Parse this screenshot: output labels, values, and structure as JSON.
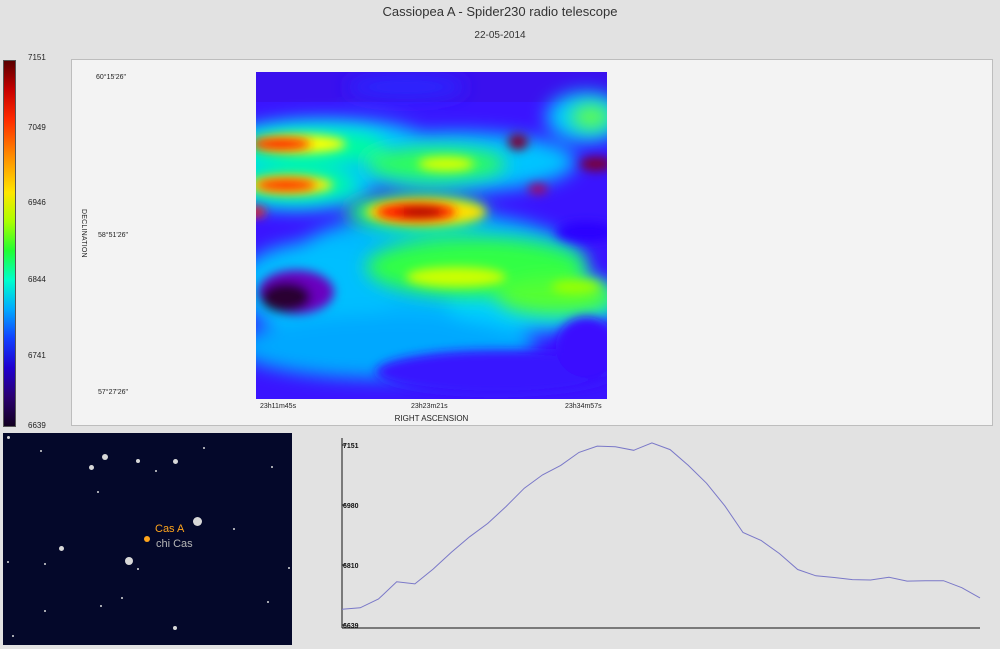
{
  "header": {
    "title": "Cassiopea A - Spider230 radio telescope",
    "date": "22-05-2014"
  },
  "colorbar": {
    "labels": [
      "7151",
      "7049",
      "6946",
      "6844",
      "6741",
      "6639"
    ],
    "min": 6639,
    "max": 7151
  },
  "heatmap": {
    "dec_labels": [
      "60°15'26\"",
      "58°51'26\"",
      "57°27'26\""
    ],
    "ra_labels": [
      "23h11m45s",
      "23h23m21s",
      "23h34m57s"
    ],
    "dec_axis_label": "DECLINATION",
    "ra_axis_label": "RIGHT ASCENSION"
  },
  "starmap": {
    "cas_a_label": "Cas A",
    "chi_cas_label": "chi Cas",
    "cas_a_color": "#ffa51c"
  },
  "chart_data": {
    "type": "line",
    "y_labels": [
      "7151",
      "6980",
      "6810",
      "6639"
    ],
    "ylim": [
      6639,
      7151
    ],
    "x": [
      0,
      1,
      2,
      3,
      4,
      5,
      6,
      7,
      8,
      9,
      10,
      11,
      12,
      13,
      14,
      15,
      16,
      17,
      18,
      19,
      20,
      21,
      22,
      23,
      24,
      25,
      26,
      27,
      28,
      29,
      30,
      31,
      32,
      33,
      34,
      35
    ],
    "values": [
      6684,
      6688,
      6713,
      6762,
      6756,
      6798,
      6846,
      6890,
      6928,
      6976,
      7028,
      7066,
      7093,
      7130,
      7148,
      7146,
      7136,
      7157,
      7138,
      7093,
      7042,
      6978,
      6902,
      6879,
      6842,
      6797,
      6779,
      6774,
      6768,
      6767,
      6775,
      6764,
      6765,
      6765,
      6745,
      6716
    ],
    "line_color": "#7a78c8"
  }
}
